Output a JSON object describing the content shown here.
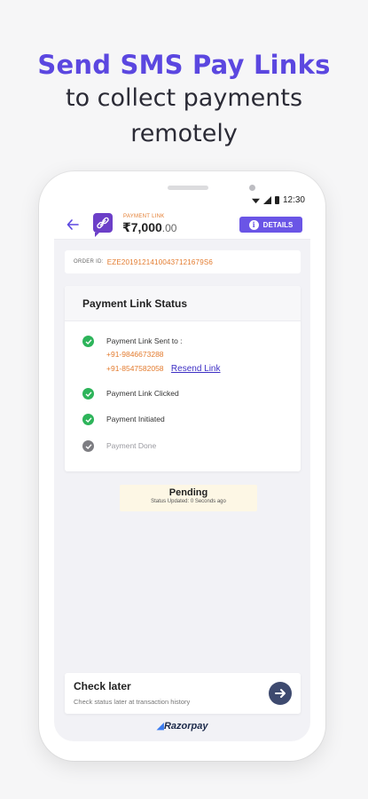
{
  "headline": {
    "title": "Send SMS Pay Links",
    "subtitle_line1": "to collect payments",
    "subtitle_line2": "remotely"
  },
  "statusbar": {
    "time": "12:30"
  },
  "appbar": {
    "label": "PAYMENT LINK",
    "amount_main": "₹7,000",
    "amount_decimal": ".00",
    "details_label": "DETAILS"
  },
  "order": {
    "label": "ORDER ID:",
    "id": "EZE20191214100437121679S6"
  },
  "status_card": {
    "title": "Payment Link Status",
    "steps": [
      {
        "label": "Payment Link Sent to :",
        "state": "done"
      },
      {
        "label": "Payment Link Clicked",
        "state": "done"
      },
      {
        "label": "Payment Initiated",
        "state": "done"
      },
      {
        "label": "Payment Done",
        "state": "pending"
      }
    ],
    "phone1": "+91-9846673288",
    "phone2": "+91-8547582058",
    "resend_label": "Resend Link"
  },
  "pending": {
    "title": "Pending",
    "subtitle": "Status Updated: 0 Seconds ago"
  },
  "check_later": {
    "title": "Check later",
    "subtitle": "Check status later at transaction history"
  },
  "brand": "Razorpay",
  "colors": {
    "accent": "#5b47e0",
    "success": "#2db45a",
    "orange": "#e37b2e",
    "link": "#3d2fc4"
  }
}
